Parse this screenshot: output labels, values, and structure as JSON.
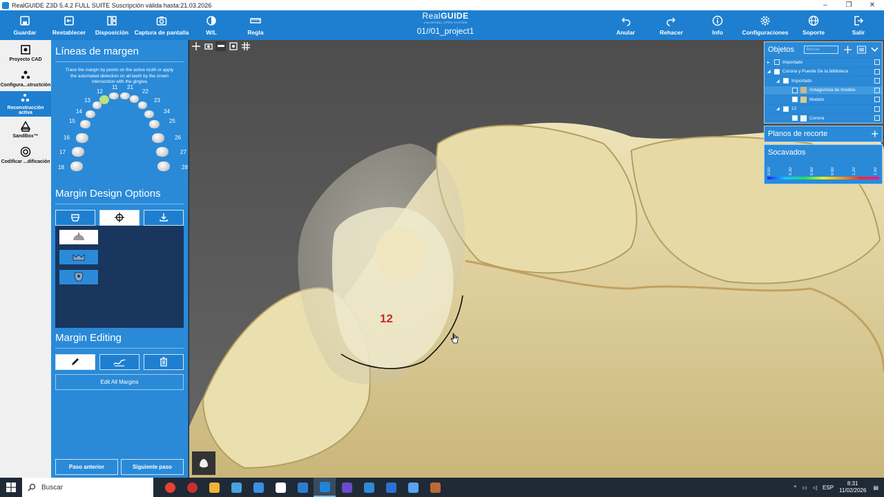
{
  "window": {
    "title": "RealGUIDE Z3D  5.4.2  FULL SUITE Suscripción válida hasta:21.03.2026",
    "controls": [
      "–",
      "❐",
      "✕"
    ]
  },
  "toolbar": {
    "left": [
      {
        "label": "Guardar",
        "icon": "save-icon"
      },
      {
        "label": "Restablecer",
        "icon": "reset-icon"
      },
      {
        "label": "Disposición",
        "icon": "layout-icon"
      },
      {
        "label": "Captura de pantalla",
        "icon": "camera-icon"
      },
      {
        "label": "W/L",
        "icon": "window-level-icon"
      },
      {
        "label": "Regla",
        "icon": "ruler-icon"
      }
    ],
    "brand": {
      "logo_light": "Real",
      "logo_bold": "GUIDE",
      "subtitle": "UNIVERSAL OPEN SYSTEM",
      "project": "01//01_project1"
    },
    "right": [
      {
        "label": "Anular",
        "icon": "undo-icon"
      },
      {
        "label": "Rehacer",
        "icon": "redo-icon"
      },
      {
        "label": "Info",
        "icon": "info-icon"
      },
      {
        "label": "Configuraciones",
        "icon": "gear-icon"
      },
      {
        "label": "Soporte",
        "icon": "globe-icon"
      },
      {
        "label": "Salir",
        "icon": "exit-icon"
      }
    ]
  },
  "nav": [
    {
      "label": "Proyecto CAD",
      "icon": "cad-project-icon",
      "active": false
    },
    {
      "label": "Configura...structción",
      "icon": "construction-config-icon",
      "active": false
    },
    {
      "label": "Reconstrucción activa",
      "icon": "active-reconstruction-icon",
      "active": true
    },
    {
      "label": "SandBox™",
      "icon": "sandbox-icon",
      "active": false
    },
    {
      "label": "Codificar ...dificación",
      "icon": "encode-icon",
      "active": false
    }
  ],
  "panel": {
    "title": "Líneas de margen",
    "hint": "Trace the margin by points on the active tooth or apply the automated detection on all teeth by the crown intersection with the gingiva",
    "teeth": [
      "18",
      "17",
      "16",
      "15",
      "14",
      "13",
      "12",
      "11",
      "21",
      "22",
      "23",
      "24",
      "25",
      "26",
      "27",
      "28"
    ],
    "selected_tooth": "12",
    "design_title": "Margin Design Options",
    "design_tabs": [
      {
        "icon": "crown-icon",
        "selected": false
      },
      {
        "icon": "crosshair-icon",
        "selected": true
      },
      {
        "icon": "import-icon",
        "selected": false
      }
    ],
    "design_options": [
      {
        "icon": "margin-shape-icon",
        "selected": true
      },
      {
        "icon": "crown-outline-icon",
        "selected": false
      },
      {
        "icon": "tooth-detect-icon",
        "selected": false
      }
    ],
    "editing_title": "Margin Editing",
    "editing_tools": [
      {
        "icon": "pencil-icon",
        "selected": true
      },
      {
        "icon": "smooth-icon",
        "selected": false
      },
      {
        "icon": "trash-icon",
        "selected": false
      }
    ],
    "edit_all": "Edit All Margins",
    "prev": "Paso anterior",
    "next": "Siguiente paso"
  },
  "viewport": {
    "tools": [
      "move-icon",
      "camera-icon",
      "jaw-icon",
      "scan-icon",
      "grid-icon"
    ],
    "tooth_label": "12",
    "corner_icon": "tooth-view-icon"
  },
  "objects": {
    "title": "Objetos",
    "search_placeholder": "Buscar",
    "rows": [
      {
        "label": "Importado",
        "level": 0,
        "arrow": "▸",
        "checked": false,
        "swatch": "",
        "selected": false
      },
      {
        "label": "Corona y Puente De la biblioteca",
        "level": 0,
        "arrow": "◢",
        "checked": true,
        "swatch": "",
        "selected": false
      },
      {
        "label": "Importado",
        "level": 1,
        "arrow": "◢",
        "checked": true,
        "swatch": "",
        "selected": false
      },
      {
        "label": "Antagonista de modelo",
        "level": 2,
        "arrow": "",
        "checked": false,
        "swatch": "#c9b98a",
        "selected": true
      },
      {
        "label": "Modelo",
        "level": 2,
        "arrow": "",
        "checked": true,
        "swatch": "#d9c990",
        "selected": false
      },
      {
        "label": "12",
        "level": 1,
        "arrow": "◢",
        "checked": true,
        "swatch": "",
        "selected": false
      },
      {
        "label": "Corona",
        "level": 2,
        "arrow": "",
        "checked": true,
        "swatch": "#f2f2f2",
        "selected": false
      }
    ]
  },
  "clipping": {
    "title": "Planos de recorte",
    "add": "+"
  },
  "undercuts": {
    "title": "Socavados",
    "scale": [
      "0.00",
      "0.30",
      "0.60",
      "0.90",
      "1.20",
      "1.50"
    ]
  },
  "taskbar": {
    "search": "Buscar",
    "apps": [
      "chrome-icon",
      "app-red-icon",
      "folder-icon",
      "app-icon",
      "app-icon",
      "app-icon",
      "app-icon",
      "realguide-icon",
      "app-icon",
      "app-icon",
      "app-icon",
      "app-icon",
      "app-icon"
    ],
    "time": "8:31",
    "date": "11/02/2026"
  },
  "colors": {
    "accent": "#1e7fd0",
    "panel": "#2a8ad8",
    "dark": "#19365e",
    "tooth": "#e4d7a6"
  }
}
